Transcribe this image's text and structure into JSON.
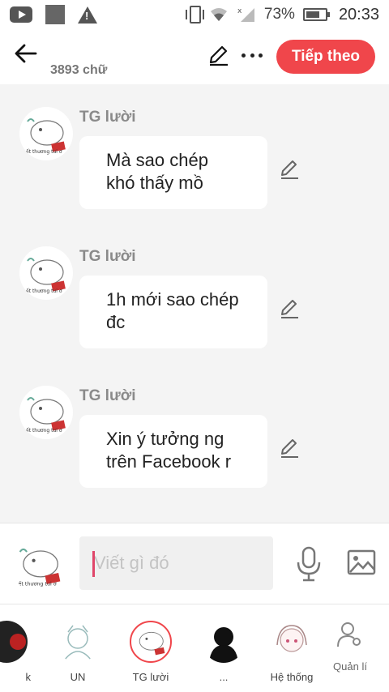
{
  "status_bar": {
    "battery": "73%",
    "time": "20:33",
    "icons": [
      "youtube-icon",
      "app-square-icon",
      "warning-icon",
      "vibrate-icon",
      "wifi-icon",
      "signal-icon",
      "battery-icon"
    ]
  },
  "top_bar": {
    "word_count": "3893 chữ",
    "next_label": "Tiếp theo",
    "accent_color": "#f0464b"
  },
  "messages": [
    {
      "sender": "TG lười",
      "line1": "Mà sao chép",
      "line2": "khó thấy mồ"
    },
    {
      "sender": "TG lười",
      "line1": "1h mới sao chép",
      "line2": "đc"
    },
    {
      "sender": "TG lười",
      "line1": "Xin ý tưởng ng",
      "line2": "trên Facebook r"
    }
  ],
  "input": {
    "placeholder": "Viết gì đó"
  },
  "characters": [
    {
      "label": "k"
    },
    {
      "label": "UN"
    },
    {
      "label": "TG lười"
    },
    {
      "label": "..."
    },
    {
      "label": "Hệ thống"
    }
  ],
  "manage_label": "Quản lí"
}
